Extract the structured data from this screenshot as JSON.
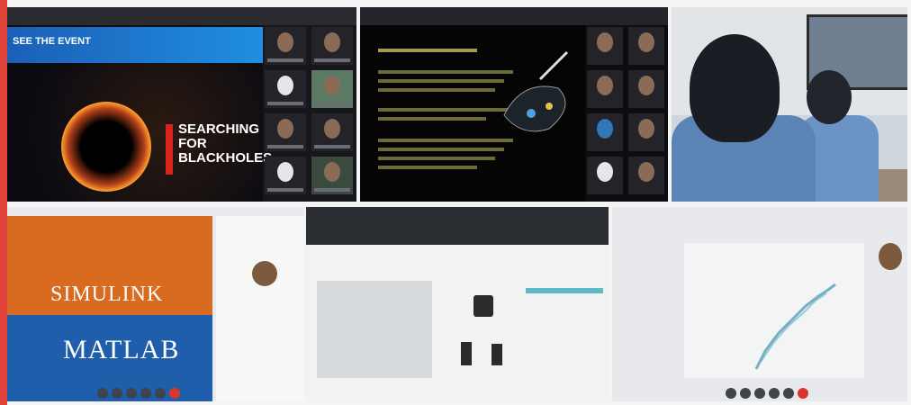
{
  "panels": {
    "webinar": {
      "banner_text": "SEE THE EVENT",
      "headline": "SEARCHING FOR BLACKHOLES"
    },
    "simulink": {
      "title1": "SIMULINK",
      "title2": "MATLAB"
    }
  },
  "colors": {
    "accent_red": "#e2443c",
    "banner_blue": "#1b5fb7",
    "matlab_orange": "#d86b1f",
    "matlab_blue": "#1f5eaa"
  }
}
